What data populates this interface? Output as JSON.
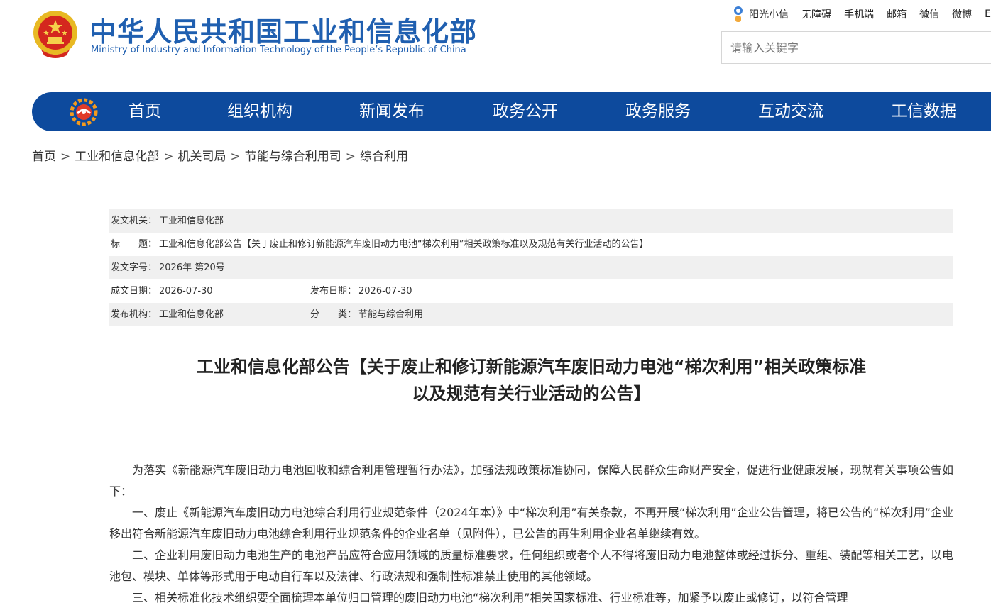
{
  "header": {
    "title_cn": "中华人民共和国工业和信息化部",
    "title_en": "Ministry of Industry and Information Technology of the People’s Republic of China",
    "top_links": [
      "阳光小信",
      "无障碍",
      "手机端",
      "邮箱",
      "微信",
      "微博",
      "E"
    ],
    "search_placeholder": "请输入关键字"
  },
  "nav": {
    "items": [
      "首页",
      "组织机构",
      "新闻发布",
      "政务公开",
      "政务服务",
      "互动交流",
      "工信数据"
    ]
  },
  "breadcrumb": [
    "首页",
    "工业和信息化部",
    "机关司局",
    "节能与综合利用司",
    "综合利用"
  ],
  "info": {
    "issuer_label": "发文机关：",
    "issuer": "工业和信息化部",
    "title_label": "标　　题：",
    "title": "工业和信息化部公告【关于废止和修订新能源汽车废旧动力电池“梯次利用”相关政策标准以及规范有关行业活动的公告】",
    "doc_no_label": "发文字号：",
    "doc_no": "2026年 第20号",
    "date_written_label": "成文日期：",
    "date_written": "2026-07-30",
    "date_published_label": "发布日期：",
    "date_published": "2026-07-30",
    "publisher_label": "发布机构：",
    "publisher": "工业和信息化部",
    "category_label": "分　　类：",
    "category": "节能与综合利用"
  },
  "article": {
    "title_line1": "工业和信息化部公告【关于废止和修订新能源汽车废旧动力电池“梯次利用”相关政策标准",
    "title_line2": "以及规范有关行业活动的公告】",
    "paragraphs": [
      "为落实《新能源汽车废旧动力电池回收和综合利用管理暂行办法》，加强法规政策标准协同，保障人民群众生命财产安全，促进行业健康发展，现就有关事项公告如下：",
      "一、废止《新能源汽车废旧动力电池综合利用行业规范条件（2024年本）》中“梯次利用”有关条款，不再开展“梯次利用”企业公告管理，将已公告的“梯次利用”企业移出符合新能源汽车废旧动力电池综合利用行业规范条件的企业名单（见附件），已公告的再生利用企业名单继续有效。",
      "二、企业利用废旧动力电池生产的电池产品应符合应用领域的质量标准要求，任何组织或者个人不得将废旧动力电池整体或经过拆分、重组、装配等相关工艺，以电池包、模块、单体等形式用于电动自行车以及法律、行政法规和强制性标准禁止使用的其他领域。",
      "三、相关标准化技术组织要全面梳理本单位归口管理的废旧动力电池“梯次利用”相关国家标准、行业标准等，加紧予以废止或修订，以符合管理"
    ]
  },
  "colors": {
    "brand_blue": "#0d4a9d",
    "title_blue": "#1f5fb0",
    "row_shade": "#f0f0f0"
  }
}
